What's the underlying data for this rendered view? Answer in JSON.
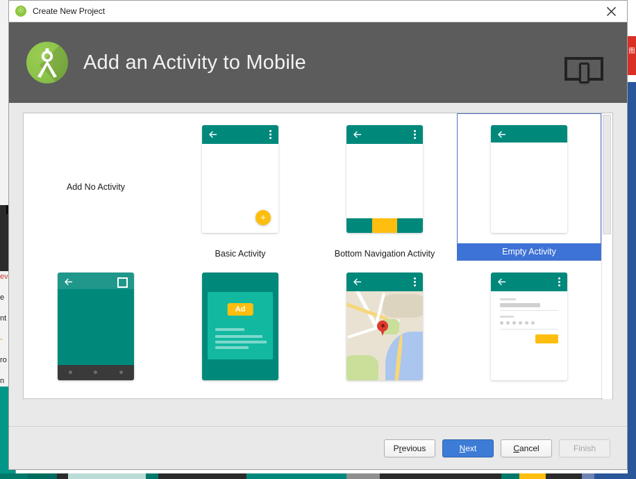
{
  "window": {
    "title": "Create New Project",
    "title_icon": "android-studio-icon",
    "close_icon": "close-icon"
  },
  "header": {
    "title": "Add an Activity to Mobile",
    "logo_icon": "android-studio-logo",
    "device_icon": "tablet-phone-icon",
    "background_color": "#5c5c5c"
  },
  "gallery": {
    "selected_index": 3,
    "accent_color": "#3d72d6",
    "template_teal": "#00897b",
    "template_amber": "#fdbe10",
    "items": [
      {
        "label": "Add No Activity",
        "thumb": "none"
      },
      {
        "label": "Basic Activity",
        "thumb": "basic-activity-thumb"
      },
      {
        "label": "Bottom Navigation Activity",
        "thumb": "bottom-navigation-activity-thumb"
      },
      {
        "label": "Empty Activity",
        "thumb": "empty-activity-thumb"
      },
      {
        "label": "",
        "thumb": "fullscreen-activity-thumb"
      },
      {
        "label": "",
        "thumb": "admob-ads-activity-thumb"
      },
      {
        "label": "",
        "thumb": "google-maps-activity-thumb"
      },
      {
        "label": "",
        "thumb": "login-activity-thumb"
      }
    ],
    "admob_badge": "Ad"
  },
  "footer": {
    "previous": {
      "pre": "P",
      "mnemonic": "r",
      "post": "evious"
    },
    "next": {
      "pre": "",
      "mnemonic": "N",
      "post": "ext"
    },
    "cancel": {
      "pre": "",
      "mnemonic": "C",
      "post": "ancel"
    },
    "finish": {
      "label": "Finish",
      "enabled": false
    }
  },
  "background": {
    "left_lines": [
      "ev",
      "e",
      "nt",
      "-",
      "ro",
      "n"
    ],
    "right_glyph": "图"
  }
}
